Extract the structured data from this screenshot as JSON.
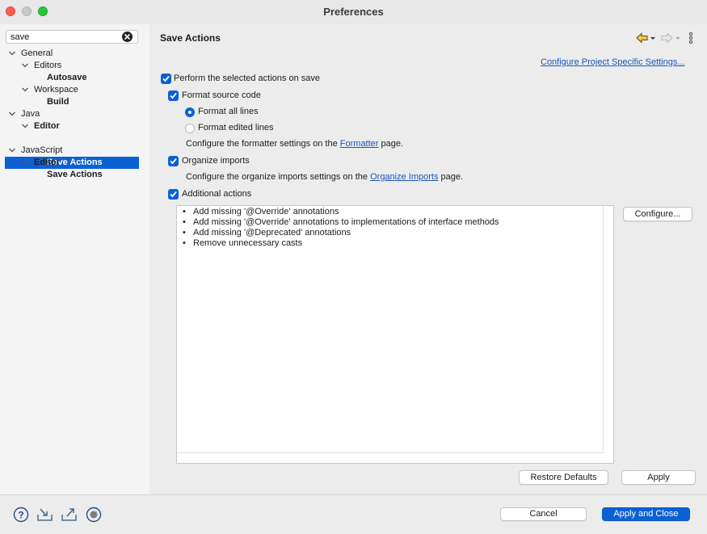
{
  "window": {
    "title": "Preferences"
  },
  "search": {
    "value": "save"
  },
  "tree": [
    {
      "label": "General"
    },
    {
      "label": "Editors"
    },
    {
      "label": "Autosave"
    },
    {
      "label": "Workspace"
    },
    {
      "label": "Build"
    },
    {
      "label": "Java"
    },
    {
      "label": "Editor"
    },
    {
      "label": "Save Actions"
    },
    {
      "label": "JavaScript"
    },
    {
      "label": "Editor"
    },
    {
      "label": "Save Actions"
    }
  ],
  "page": {
    "title": "Save Actions",
    "project_link": "Configure Project Specific Settings...",
    "perform_label": "Perform the selected actions on save",
    "format_label": "Format source code",
    "format_all": "Format all lines",
    "format_edited": "Format edited lines",
    "formatter_pre": "Configure the formatter settings on the",
    "formatter_link": "Formatter",
    "formatter_post": "page.",
    "organize_label": "Organize imports",
    "organize_pre": "Configure the organize imports settings on the",
    "organize_link": "Organize Imports",
    "organize_post": "page.",
    "additional_label": "Additional actions",
    "actions": [
      "Add missing '@Override' annotations",
      "Add missing '@Override' annotations to implementations of interface methods",
      "Add missing '@Deprecated' annotations",
      "Remove unnecessary casts"
    ],
    "bullet": "•",
    "configure_button": "Configure...",
    "restore_button": "Restore Defaults",
    "apply_button": "Apply"
  },
  "footer": {
    "cancel_button": "Cancel",
    "apply_close_button": "Apply and Close"
  },
  "state": {
    "perform_checked": true,
    "format_checked": true,
    "format_mode": "all lines",
    "organize_checked": true,
    "additional_checked": true
  },
  "colors": {
    "accent": "#0b61d4",
    "link": "#1a56b8",
    "close": "#fe5f57",
    "maximize": "#29c440"
  },
  "icons": [
    "help-icon",
    "import-icon",
    "export-icon",
    "record-icon",
    "back-arrow-icon",
    "forward-arrow-icon",
    "more-menu-icon"
  ]
}
